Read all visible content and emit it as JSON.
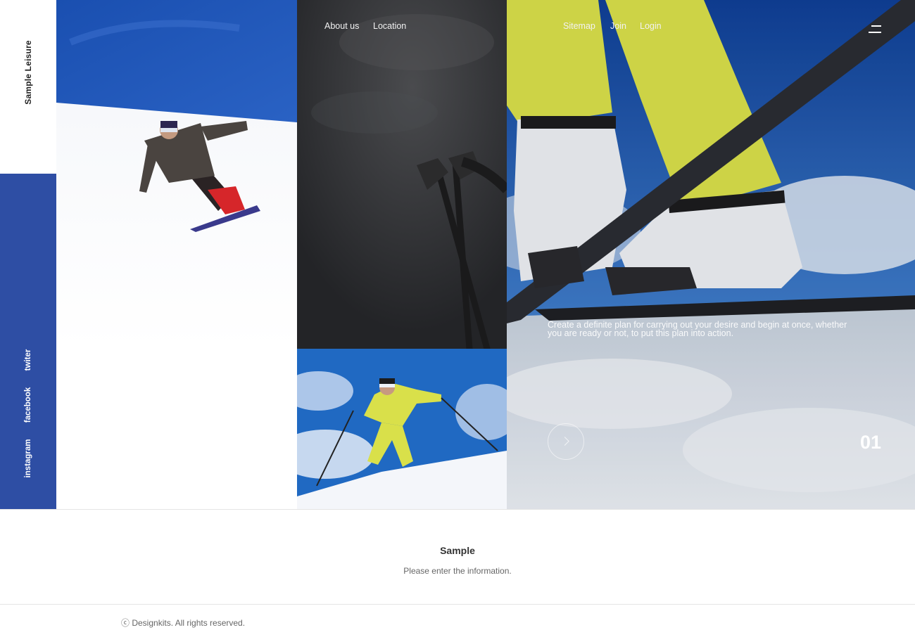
{
  "brand": {
    "name": "Sample Leisure"
  },
  "social": {
    "twitter": "twiter",
    "facebook": "facebook",
    "instagram": "instagram"
  },
  "nav": {
    "left": [
      "About us",
      "Location"
    ],
    "right": [
      "Sitemap",
      "Join",
      "Login"
    ],
    "menu_icon": "hamburger-menu-icon"
  },
  "hero": {
    "text": "Create a definite plan for carrying out your desire and begin at once, whether you are ready or not, to put this plan into action.",
    "slide_number": "01",
    "next_icon": "chevron-right-icon"
  },
  "info": {
    "title": "Sample",
    "text": "Please enter the information."
  },
  "footer": {
    "copyright": "ⓒ Designkits. All rights reserved."
  },
  "colors": {
    "accent": "#2e4ea4",
    "sky": "#1f5ab4",
    "ski_pants": "#d9e04a"
  }
}
